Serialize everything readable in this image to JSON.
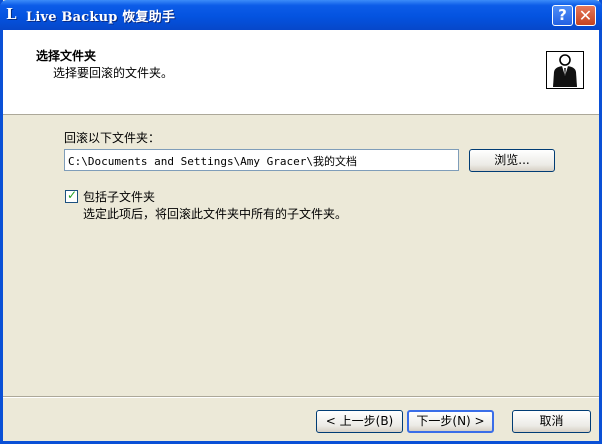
{
  "window": {
    "app_icon_glyph": "L",
    "title": "Live Backup 恢复助手",
    "help_glyph": "?",
    "close_glyph": "✕"
  },
  "header": {
    "title": "选择文件夹",
    "subtitle": "选择要回滚的文件夹。",
    "logo_icon": "person-icon"
  },
  "form": {
    "folder_label": "回滚以下文件夹：",
    "folder_value": "C:\\Documents and Settings\\Amy Gracer\\我的文档",
    "browse_label": "浏览...",
    "include_subfolders_label": "包括子文件夹",
    "include_subfolders_checked": true,
    "include_subfolders_hint": "选定此项后，将回滚此文件夹中所有的子文件夹。"
  },
  "footer": {
    "back_label": "< 上一步(B)",
    "next_label": "下一步(N) >",
    "cancel_label": "取消"
  },
  "colors": {
    "titlebar": "#0453e0",
    "dialog_bg": "#ece9d8",
    "checkmark": "#21a121"
  }
}
